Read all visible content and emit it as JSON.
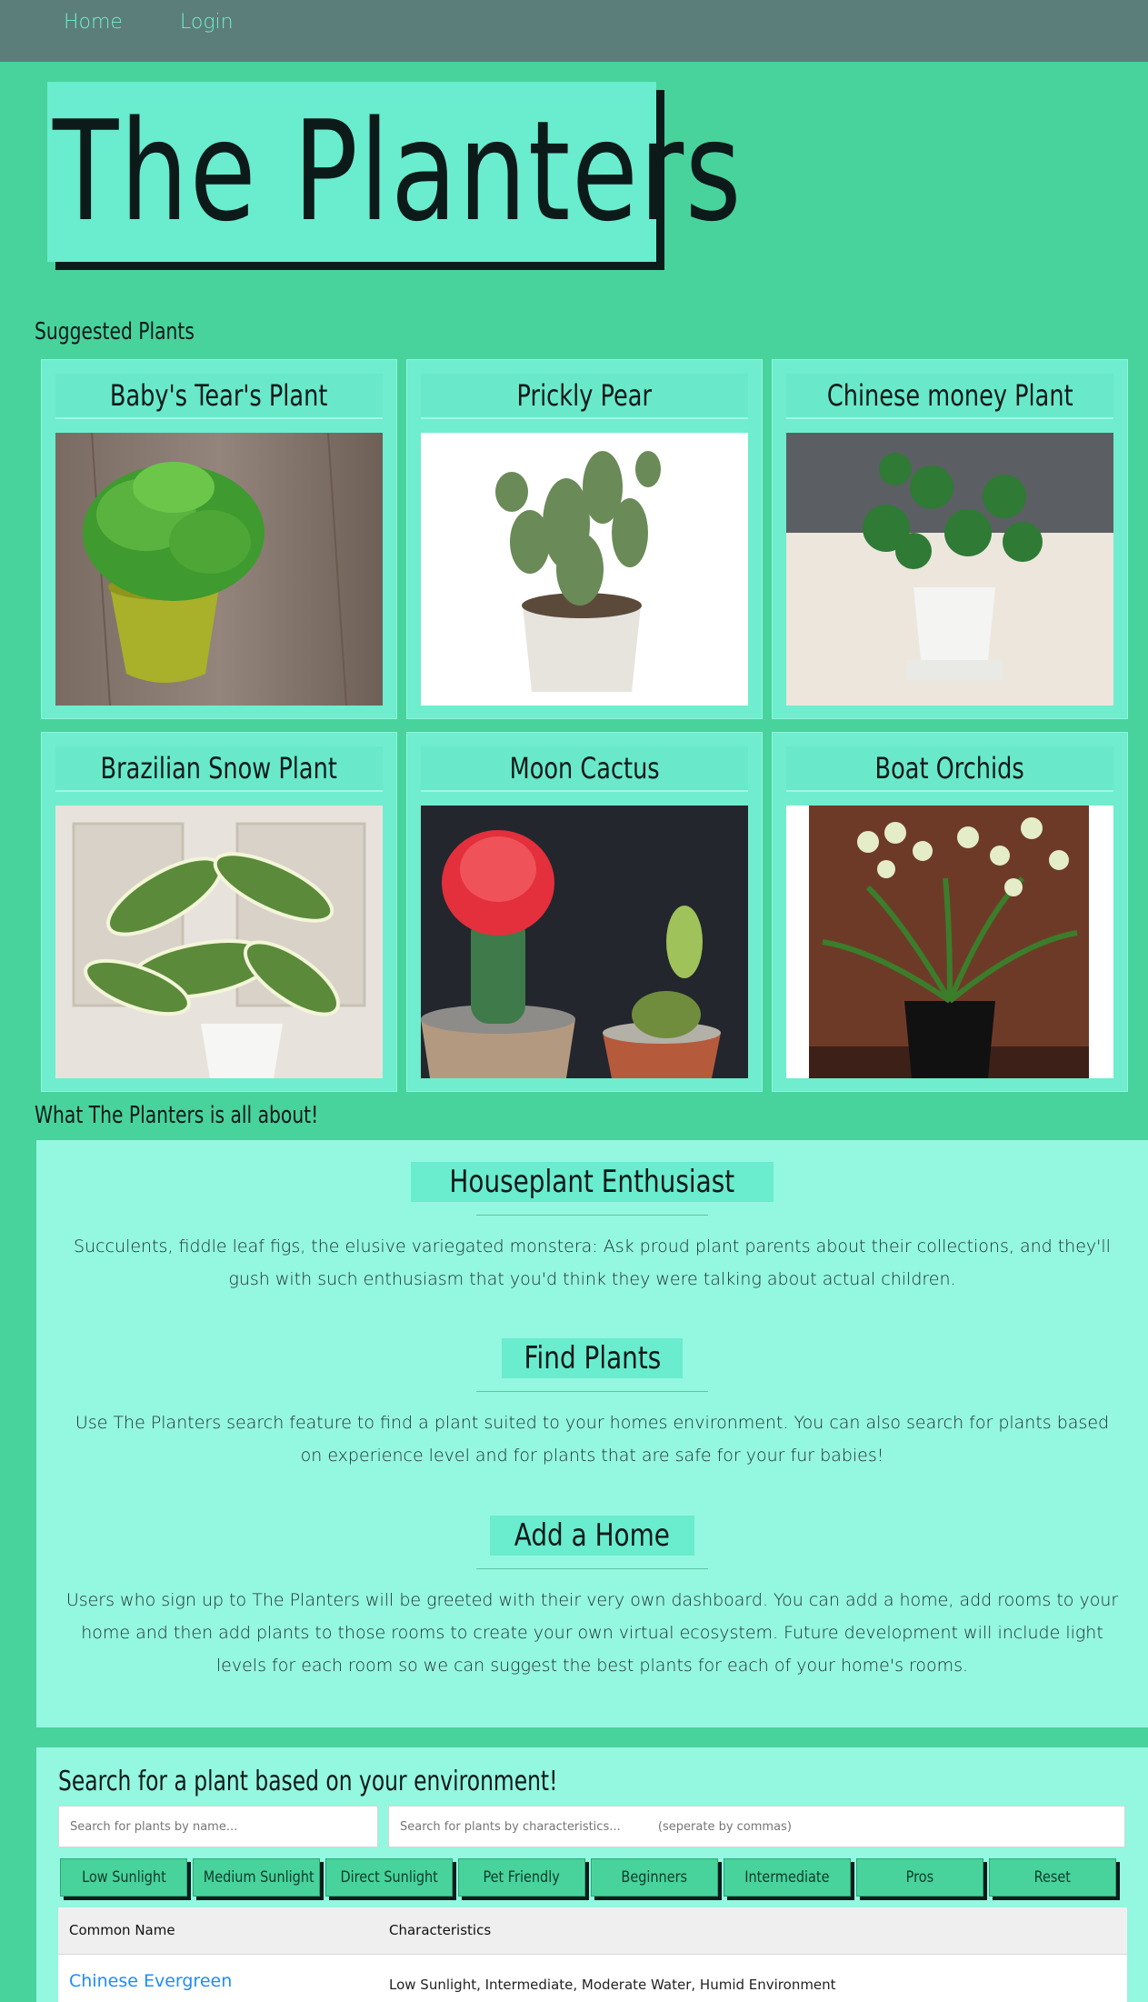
{
  "nav": {
    "home": "Home",
    "login": "Login"
  },
  "hero": {
    "title": "The Planters"
  },
  "suggested": {
    "heading": "Suggested Plants",
    "cards": [
      {
        "name": "Baby's Tear's Plant"
      },
      {
        "name": "Prickly Pear"
      },
      {
        "name": "Chinese money Plant"
      },
      {
        "name": "Brazilian Snow Plant"
      },
      {
        "name": "Moon Cactus"
      },
      {
        "name": "Boat Orchids"
      }
    ]
  },
  "about": {
    "heading": "What The Planters is all about!",
    "sections": [
      {
        "title": "Houseplant Enthusiast",
        "text": "Succulents, fiddle leaf figs, the elusive variegated monstera: Ask proud plant parents about their collections, and they'll gush with such enthusiasm that you'd think they were talking about actual children."
      },
      {
        "title": "Find Plants",
        "text": "Use The Planters search feature to find a plant suited to your homes environment. You can also search for plants based on experience level and for plants that are safe for your fur babies!"
      },
      {
        "title": "Add a Home",
        "text": "Users who sign up to The Planters will be greeted with their very own dashboard. You can add a home, add rooms to your home and then add plants to those rooms to create your own virtual ecosystem. Future development will include light levels for each room so we can suggest the best plants for each of your home's rooms."
      }
    ]
  },
  "search": {
    "title": "Search for a plant based on your environment!",
    "name_placeholder": "Search for plants by name...",
    "char_placeholder": "Search for plants by characteristics...          (seperate by commas)",
    "filters": [
      "Low Sunlight",
      "Medium Sunlight",
      "Direct Sunlight",
      "Pet Friendly",
      "Beginners",
      "Intermediate",
      "Pros",
      "Reset"
    ],
    "table": {
      "columns": [
        "Common Name",
        "Characteristics"
      ],
      "rows": [
        {
          "name": "Chinese Evergreen",
          "characteristics": "Low Sunlight, Intermediate, Moderate Water, Humid Environment"
        }
      ]
    }
  },
  "colors": {
    "background": "#48d39c",
    "navbar": "#5c7e7a",
    "nav_link": "#6ff0cc",
    "card": "#6fedce",
    "panel": "#94f7e0",
    "link": "#1a8cff"
  }
}
